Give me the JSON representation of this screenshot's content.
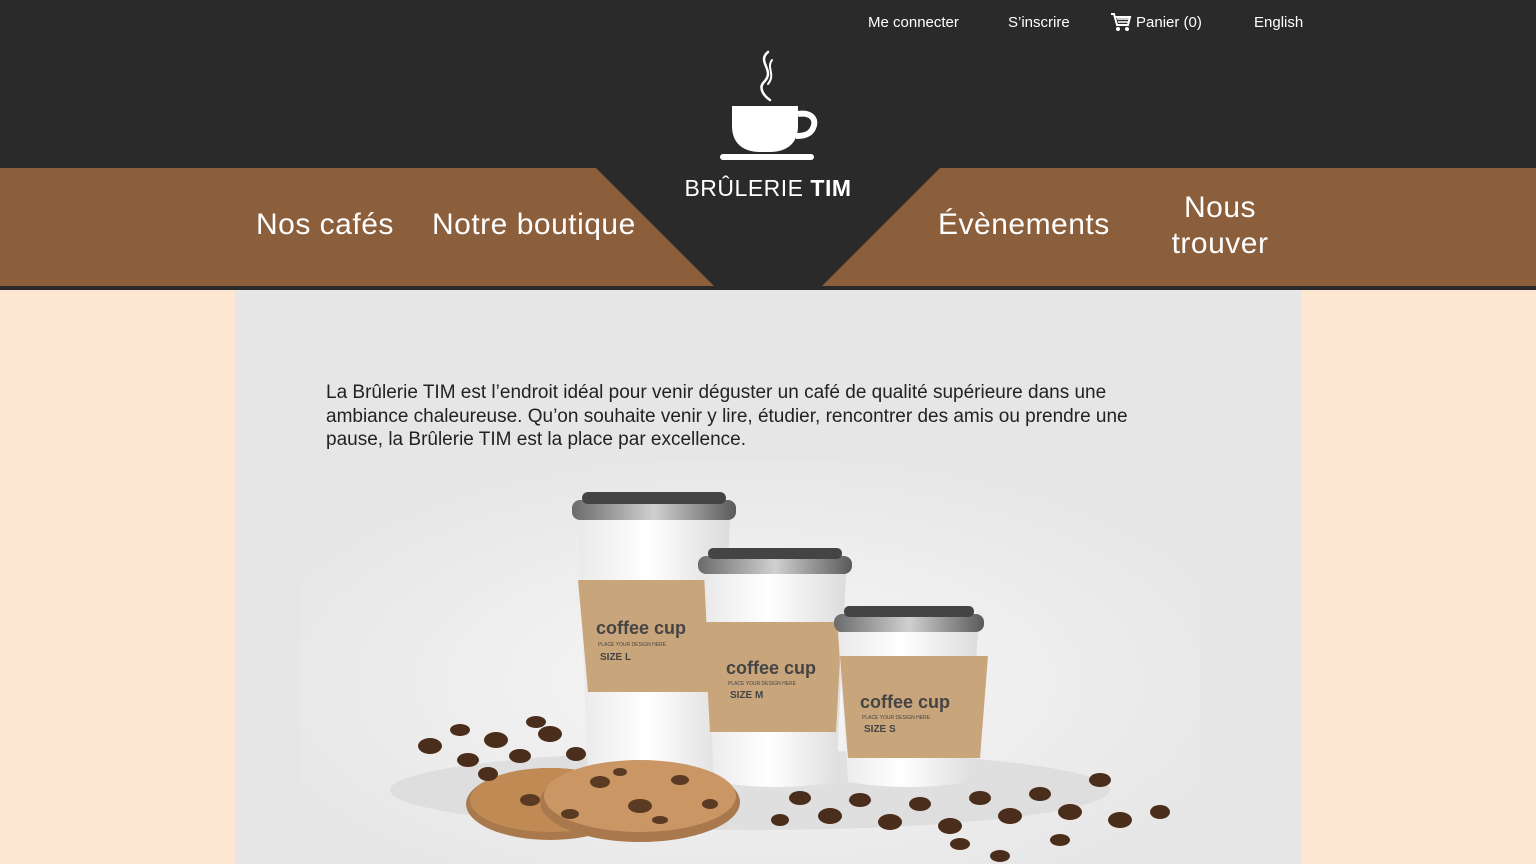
{
  "utility_nav": {
    "login": "Me connecter",
    "signup": "S’inscrire",
    "cart": "Panier (0)",
    "language": "English"
  },
  "brand": {
    "name_light": "BRÛLERIE",
    "name_bold": "TIM"
  },
  "main_nav": {
    "cafes": "Nos cafés",
    "boutique": "Notre boutique",
    "events": "Évènements",
    "find": "Nous\ntrouver"
  },
  "intro_text": "La Brûlerie TIM est l’endroit idéal pour venir déguster un café de qualité supérieure dans une ambiance chaleureuse. Qu’on souhaite venir y lire, étudier, rencontrer des amis ou prendre une pause, la Brûlerie TIM est la place par excellence.",
  "hero": {
    "cups": [
      {
        "brand": "coffee cup",
        "tagline": "PLACE YOUR DESIGN HERE",
        "size": "SIZE L"
      },
      {
        "brand": "coffee cup",
        "tagline": "PLACE YOUR DESIGN HERE",
        "size": "SIZE M"
      },
      {
        "brand": "coffee cup",
        "tagline": "PLACE YOUR DESIGN HERE",
        "size": "SIZE S"
      }
    ]
  },
  "colors": {
    "header": "#2a2a2a",
    "nav_band": "#8b5e3c",
    "page_bg": "#fde6d2",
    "content_bg": "#e6e6e6",
    "sleeve": "#c9a57c"
  },
  "icons": {
    "cart": "cart-icon",
    "logo": "coffee-cup-logo-icon"
  }
}
